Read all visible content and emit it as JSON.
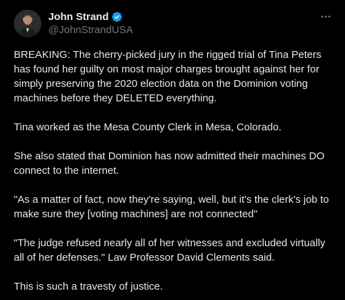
{
  "author": {
    "name": "John Strand",
    "handle": "@JohnStrandUSA",
    "verified": true,
    "verified_color": "#1d9bf0"
  },
  "actions": {
    "more_icon": "more-horizontal-icon"
  },
  "post": {
    "paragraphs": [
      "BREAKING: The cherry-picked jury in the rigged trial of Tina Peters has found her guilty on most major charges brought against her for simply preserving the 2020 election data on the Dominion voting machines before they DELETED everything.",
      "Tina worked as the Mesa County Clerk in Mesa, Colorado.",
      "She also stated that Dominion has now admitted their machines DO connect to the internet.",
      "\"As a matter of fact, now they're saying, well, but it's the clerk's job to make sure they [voting machines] are not connected\"",
      "\"The judge refused nearly all of her witnesses and excluded virtually all of her defenses.\" Law Professor David Clements said.",
      "This is such a travesty of justice."
    ]
  },
  "theme": {
    "background": "#000000",
    "text": "#e7e9ea",
    "secondary_text": "#71767b"
  }
}
